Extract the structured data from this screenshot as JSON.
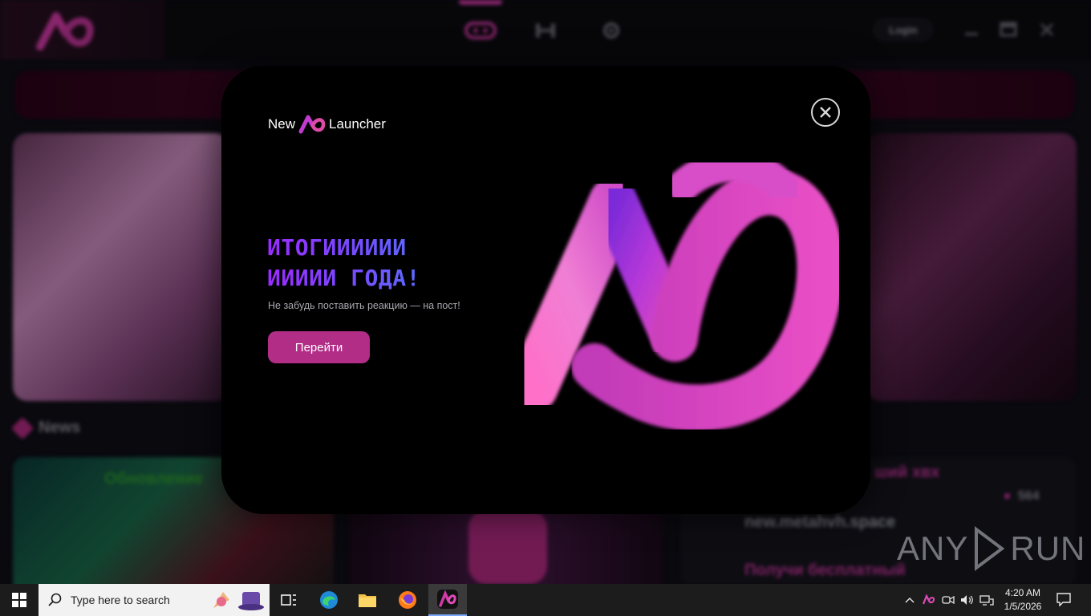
{
  "background_app": {
    "login_label": "Login",
    "news_title": "News",
    "news_card_title": "Обновление",
    "side_rows": [
      {
        "text": "ший хвх",
        "color": "#c2359a"
      },
      {
        "text": "new.metahvh.space",
        "color": "#9a9aa6"
      },
      {
        "text": "Получи бесплатный",
        "color": "#c2359a"
      }
    ],
    "side_count": "564"
  },
  "modal": {
    "brand_left": "New",
    "brand_right": "Launcher",
    "headline_line1": "ИТОГИИИИИИ",
    "headline_line2": "ИИИИИ ГОДА!",
    "subtitle": "Не забудь поставить реакцию — на пост!",
    "cta_label": "Перейти",
    "accent": "#b12d86"
  },
  "taskbar": {
    "search_placeholder": "Type here to search",
    "time": "4:20 AM",
    "date": "1/5/2026"
  },
  "watermark": {
    "left": "ANY",
    "right": "RUN"
  }
}
